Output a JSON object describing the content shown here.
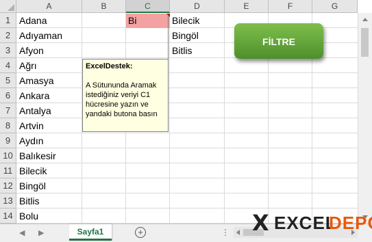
{
  "sheet": {
    "columns": [
      "A",
      "B",
      "C",
      "D",
      "E",
      "F",
      "G"
    ],
    "rows": [
      "1",
      "2",
      "3",
      "4",
      "5",
      "6",
      "7",
      "8",
      "9",
      "10",
      "11",
      "12",
      "13",
      "14"
    ],
    "column_a": [
      "Adana",
      "Adıyaman",
      "Afyon",
      "Ağrı",
      "Amasya",
      "Ankara",
      "Antalya",
      "Artvin",
      "Aydın",
      "Balıkesir",
      "Bilecik",
      "Bingöl",
      "Bitlis",
      "Bolu"
    ],
    "c1_value": "Bi",
    "column_d": [
      "Bilecik",
      "Bingöl",
      "Bitlis"
    ],
    "highlight_color": "#f4a1a1"
  },
  "note": {
    "title": "ExcelDestek:",
    "body": "A Sütununda Aramak istediğiniz veriyi C1 hücresine yazın ve yandaki butona basın"
  },
  "filter_button": {
    "label": "FİLTRE"
  },
  "tabs": {
    "sheet_tab": "Sayfa1",
    "add_sheet": "+",
    "more": "⋮"
  },
  "watermark": {
    "part1": "EXCEL",
    "part2": "DEPO"
  }
}
